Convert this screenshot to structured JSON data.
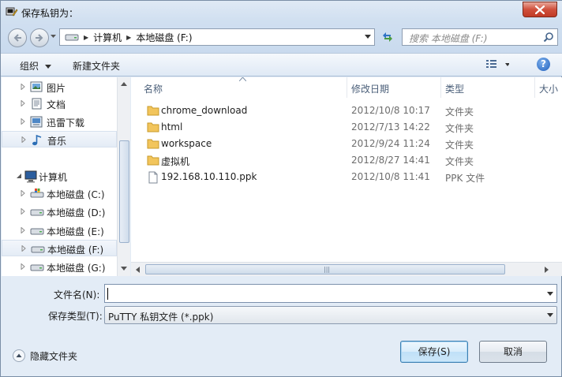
{
  "window": {
    "title": "保存私钥为："
  },
  "address": {
    "segments": [
      "计算机",
      "本地磁盘 (F:)"
    ]
  },
  "search": {
    "placeholder": "搜索 本地磁盘 (F:)"
  },
  "toolbar": {
    "organize": "组织",
    "new_folder": "新建文件夹"
  },
  "nav": {
    "items": [
      {
        "label": "图片",
        "icon": "pictures-icon"
      },
      {
        "label": "文档",
        "icon": "documents-icon"
      },
      {
        "label": "迅雷下载",
        "icon": "downloads-icon"
      },
      {
        "label": "音乐",
        "icon": "music-icon",
        "selected": true
      },
      {
        "label": "计算机",
        "icon": "computer-icon"
      },
      {
        "label": "本地磁盘 (C:)",
        "icon": "windows-drive-icon"
      },
      {
        "label": "本地磁盘 (D:)",
        "icon": "drive-icon"
      },
      {
        "label": "本地磁盘 (E:)",
        "icon": "drive-icon"
      },
      {
        "label": "本地磁盘 (F:)",
        "icon": "drive-icon",
        "selected": true
      },
      {
        "label": "本地磁盘 (G:)",
        "icon": "drive-icon"
      }
    ]
  },
  "columns": {
    "name": "名称",
    "date": "修改日期",
    "type": "类型",
    "size": "大小"
  },
  "files": [
    {
      "name": "chrome_download",
      "date": "2012/10/8 10:17",
      "type": "文件夹",
      "kind": "folder"
    },
    {
      "name": "html",
      "date": "2012/7/13 14:22",
      "type": "文件夹",
      "kind": "folder"
    },
    {
      "name": "workspace",
      "date": "2012/9/24 11:24",
      "type": "文件夹",
      "kind": "folder"
    },
    {
      "name": "虚拟机",
      "date": "2012/8/27 14:41",
      "type": "文件夹",
      "kind": "folder"
    },
    {
      "name": "192.168.10.110.ppk",
      "date": "2012/10/8 11:41",
      "type": "PPK 文件",
      "kind": "file"
    }
  ],
  "form": {
    "filename_label": "文件名(N):",
    "filename_value": "",
    "type_label": "保存类型(T):",
    "type_value": "PuTTY 私钥文件 (*.ppk)"
  },
  "footer": {
    "hide_folders": "隐藏文件夹",
    "save": "保存(S)",
    "cancel": "取消"
  },
  "colors": {
    "folder": "#f2c55c",
    "accent": "#3c7fb1"
  }
}
